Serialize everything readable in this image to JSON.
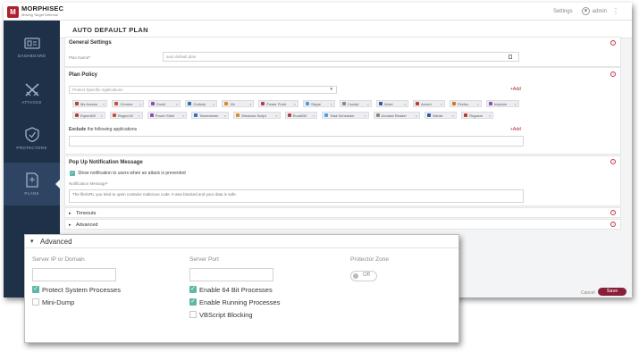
{
  "topbar": {
    "logo_mark": "M",
    "brand": "MORPHISEC",
    "tagline": "Moving Target Defense",
    "settings": "Settings",
    "user": "admin",
    "menu": "⋮"
  },
  "sidebar": {
    "items": [
      {
        "label": "DASHBOARD",
        "icon": "dashboard-icon"
      },
      {
        "label": "ATTACKS",
        "icon": "attacks-icon"
      },
      {
        "label": "PROTECTORS",
        "icon": "shield-icon"
      },
      {
        "label": "PLANS",
        "icon": "plans-icon",
        "active": true
      }
    ]
  },
  "page": {
    "title": "AUTO DEFAULT PLAN"
  },
  "general": {
    "title": "General Settings",
    "plan_name_label": "Plan Name",
    "required_mark": "*",
    "plan_name_value": "auto default plan"
  },
  "policy": {
    "title": "Plan Policy",
    "select_placeholder": "Protect Specific Applications",
    "add": "+Add",
    "chips_row1": [
      "Ms Access",
      "Chrome",
      "Excel",
      "Outlook",
      "Vlc",
      "Power Point",
      "Skype",
      "Cscript",
      "Word",
      "Acrord",
      "Firefox",
      "Iexplore"
    ],
    "chips_row2": [
      "Eqnedt32",
      "Regsvr32",
      "Power Shell",
      "Teamviewer",
      "Windows Script",
      "Rundll32",
      "Task Scheduler",
      "Acrobat Reader",
      "Mshta",
      "Regasm"
    ],
    "chip_remove": "×",
    "exclude_bold": "Exclude",
    "exclude_rest": "the following applications",
    "exclude_add": "+Add"
  },
  "popup": {
    "title": "Pop Up Notification Message",
    "show_label": "Show notification to users when an attack is prevented",
    "message_label": "Notification Message",
    "message_value": "The file/URL you tried to open contains malicious code. It was blocked and your data is safe."
  },
  "timeouts": {
    "title": "Timeouts"
  },
  "advanced_small": {
    "title": "Advanced"
  },
  "footer": {
    "cancel": "Cancel",
    "save": "Save"
  },
  "advanced": {
    "title": "Advanced",
    "server_ip_label": "Server IP or Domain",
    "server_port_label": "Server Port",
    "protector_zone_label": "Protector Zone",
    "toggle_label": "Off",
    "options": [
      {
        "label": "Protect System Processes",
        "checked": true
      },
      {
        "label": "Mini-Dump",
        "checked": false
      },
      {
        "label": "Enable 64 Bit Processes",
        "checked": true
      },
      {
        "label": "Enable Running Processes",
        "checked": true
      },
      {
        "label": "VBScript Blocking",
        "checked": false
      }
    ]
  },
  "colors": {
    "accent": "#b01f2e",
    "sidebar": "#1f3148",
    "check": "#5fb7a6",
    "save": "#8a1f3a"
  }
}
